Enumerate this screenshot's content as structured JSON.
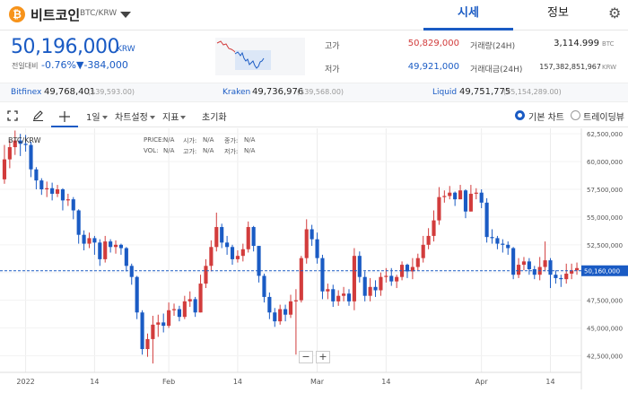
{
  "header": {
    "coin_symbol": "₿",
    "coin_name": "비트코인",
    "pair": "BTC/KRW",
    "tabs": [
      "시세",
      "정보"
    ],
    "settings_icon": "gear-icon"
  },
  "ticker": {
    "price": "50,196,000",
    "unit": "KRW",
    "change_label": "전일대비",
    "change_pct": "-0.76%",
    "change_amt": "▼-384,000",
    "color_down": "#1a5bc4",
    "color_up": "#d23c3c"
  },
  "stats": {
    "high_label": "고가",
    "high_value": "50,829,000",
    "low_label": "저가",
    "low_value": "49,921,000",
    "volume_label": "거래량(24H)",
    "volume_value": "3,114.999",
    "volume_unit": "BTC",
    "amount_label": "거래대금(24H)",
    "amount_value": "157,382,851,967",
    "amount_unit": "KRW"
  },
  "exchanges": [
    {
      "name": "Bitfinex",
      "price": "49,768,401",
      "sub": "($39,593.00)"
    },
    {
      "name": "Kraken",
      "price": "49,736,976",
      "sub": "($39,568.00)"
    },
    {
      "name": "Liquid",
      "price": "49,751,775",
      "sub": "(¥5,154,289.00)"
    }
  ],
  "toolbar": {
    "period": "1일",
    "chart_settings": "차트설정",
    "indicators": "지표",
    "reset": "초기화",
    "basic_chart": "기본 차트",
    "tradingview": "트레이딩뷰"
  },
  "legend": {
    "pair": "BTC/KRW",
    "price": "PRICE:",
    "price_v": "N/A",
    "open": "시가:",
    "open_v": "N/A",
    "close": "종가:",
    "close_v": "N/A",
    "vol": "VOL:",
    "vol_v": "N/A",
    "high": "고가:",
    "high_v": "N/A",
    "low": "저가:",
    "low_v": "N/A"
  },
  "chart_data": {
    "type": "candlestick",
    "ylim": [
      41000000,
      63000000
    ],
    "y_ticks": [
      "62,500,000",
      "60,000,000",
      "57,500,000",
      "55,000,000",
      "52,500,000",
      "50,000,000",
      "47,500,000",
      "45,000,000",
      "42,500,000"
    ],
    "y_tick_values": [
      62500000,
      60000000,
      57500000,
      55000000,
      52500000,
      50000000,
      47500000,
      45000000,
      42500000
    ],
    "x_labels": [
      "2022",
      "14",
      "Feb",
      "14",
      "Mar",
      "14",
      "Apr",
      "14",
      "Ma"
    ],
    "x_label_index": [
      4,
      17,
      31,
      44,
      59,
      72,
      90,
      103,
      121
    ],
    "current_price_label": "50,160,000",
    "current_price": 50160000,
    "candles": [
      [
        58.4,
        60.2,
        61.5,
        58.0
      ],
      [
        60.2,
        61.3,
        61.9,
        59.4
      ],
      [
        61.3,
        61.9,
        62.8,
        60.6
      ],
      [
        61.9,
        61.6,
        62.5,
        60.5
      ],
      [
        61.6,
        61.5,
        62.4,
        60.9
      ],
      [
        61.5,
        59.3,
        61.8,
        58.6
      ],
      [
        59.3,
        58.3,
        59.5,
        57.5
      ],
      [
        58.3,
        57.5,
        58.5,
        57.0
      ],
      [
        57.5,
        57.6,
        58.2,
        56.8
      ],
      [
        57.6,
        57.1,
        58.1,
        56.5
      ],
      [
        57.1,
        57.5,
        57.9,
        56.8
      ],
      [
        57.5,
        56.5,
        57.6,
        55.6
      ],
      [
        56.5,
        56.6,
        57.1,
        56.0
      ],
      [
        56.6,
        55.6,
        56.8,
        54.8
      ],
      [
        55.6,
        53.4,
        55.7,
        52.6
      ],
      [
        53.4,
        52.6,
        53.8,
        52.0
      ],
      [
        52.6,
        53.1,
        53.6,
        52.2
      ],
      [
        53.1,
        52.7,
        53.3,
        51.6
      ],
      [
        52.7,
        51.2,
        53.0,
        50.6
      ],
      [
        51.2,
        52.8,
        53.3,
        50.9
      ],
      [
        52.8,
        52.3,
        53.0,
        51.8
      ],
      [
        52.3,
        52.5,
        52.9,
        51.7
      ],
      [
        52.5,
        52.2,
        52.6,
        51.6
      ],
      [
        52.2,
        50.6,
        52.3,
        50.1
      ],
      [
        50.6,
        49.6,
        50.8,
        48.9
      ],
      [
        49.6,
        46.4,
        49.7,
        45.8
      ],
      [
        46.4,
        43.1,
        46.6,
        42.6
      ],
      [
        43.1,
        44.0,
        44.5,
        42.4
      ],
      [
        44.0,
        45.3,
        46.1,
        41.8
      ],
      [
        45.3,
        45.5,
        46.2,
        44.2
      ],
      [
        45.5,
        45.2,
        46.3,
        44.6
      ],
      [
        45.2,
        46.6,
        47.3,
        45.0
      ],
      [
        46.6,
        46.7,
        47.2,
        46.1
      ],
      [
        46.7,
        46.0,
        47.0,
        45.6
      ],
      [
        46.0,
        47.4,
        47.9,
        45.8
      ],
      [
        47.4,
        47.6,
        48.3,
        46.9
      ],
      [
        47.6,
        46.4,
        47.8,
        46.0
      ],
      [
        46.4,
        49.0,
        49.8,
        46.4
      ],
      [
        49.0,
        50.6,
        51.2,
        48.6
      ],
      [
        50.6,
        52.3,
        52.9,
        50.1
      ],
      [
        52.3,
        54.1,
        55.4,
        51.9
      ],
      [
        54.1,
        52.7,
        54.4,
        52.2
      ],
      [
        52.7,
        52.3,
        53.3,
        51.6
      ],
      [
        52.3,
        51.2,
        52.5,
        50.7
      ],
      [
        51.2,
        51.5,
        52.0,
        50.9
      ],
      [
        51.5,
        52.1,
        52.6,
        51.0
      ],
      [
        52.1,
        54.1,
        54.6,
        51.8
      ],
      [
        54.1,
        52.4,
        54.2,
        51.9
      ],
      [
        52.4,
        49.7,
        52.4,
        49.1
      ],
      [
        49.7,
        47.8,
        49.9,
        47.3
      ],
      [
        47.8,
        46.4,
        48.2,
        45.8
      ],
      [
        46.4,
        45.6,
        46.8,
        45.1
      ],
      [
        45.6,
        46.7,
        47.1,
        45.3
      ],
      [
        46.7,
        46.2,
        47.1,
        45.6
      ],
      [
        46.2,
        47.4,
        48.0,
        45.9
      ],
      [
        47.4,
        47.5,
        48.5,
        42.6
      ],
      [
        47.5,
        51.3,
        51.5,
        47.3
      ],
      [
        51.3,
        53.9,
        54.8,
        50.8
      ],
      [
        53.9,
        53.0,
        54.3,
        52.4
      ],
      [
        53.0,
        51.3,
        53.6,
        50.8
      ],
      [
        51.3,
        48.3,
        51.6,
        47.6
      ],
      [
        48.3,
        48.5,
        49.0,
        47.6
      ],
      [
        48.5,
        47.4,
        48.9,
        46.9
      ],
      [
        47.4,
        47.9,
        48.4,
        47.0
      ],
      [
        47.9,
        48.1,
        48.7,
        47.4
      ],
      [
        48.1,
        47.4,
        48.5,
        47.0
      ],
      [
        47.4,
        51.5,
        52.2,
        46.6
      ],
      [
        51.5,
        49.6,
        51.9,
        49.1
      ],
      [
        49.6,
        47.9,
        50.1,
        47.4
      ],
      [
        47.9,
        48.7,
        49.5,
        47.4
      ],
      [
        48.7,
        48.4,
        49.3,
        47.8
      ],
      [
        48.4,
        49.6,
        50.0,
        47.9
      ],
      [
        49.6,
        49.7,
        50.4,
        49.1
      ],
      [
        49.7,
        49.2,
        50.4,
        48.8
      ],
      [
        49.2,
        49.6,
        49.8,
        48.6
      ],
      [
        49.6,
        50.7,
        51.0,
        49.3
      ],
      [
        50.7,
        50.1,
        50.8,
        49.5
      ],
      [
        50.1,
        50.5,
        51.3,
        49.4
      ],
      [
        50.5,
        51.3,
        51.7,
        50.2
      ],
      [
        51.3,
        52.5,
        53.3,
        50.9
      ],
      [
        52.5,
        53.3,
        54.0,
        52.1
      ],
      [
        53.3,
        54.7,
        55.6,
        52.8
      ],
      [
        54.7,
        56.8,
        57.7,
        54.3
      ],
      [
        56.8,
        56.9,
        57.4,
        56.3
      ],
      [
        56.9,
        57.2,
        57.8,
        56.6
      ],
      [
        57.2,
        56.6,
        57.3,
        56.0
      ],
      [
        56.6,
        57.4,
        57.9,
        56.6
      ],
      [
        57.4,
        55.5,
        57.5,
        54.9
      ],
      [
        55.5,
        57.1,
        57.9,
        55.5
      ],
      [
        57.1,
        57.2,
        57.6,
        56.6
      ],
      [
        57.2,
        56.3,
        57.5,
        55.8
      ],
      [
        56.3,
        53.2,
        56.7,
        52.7
      ],
      [
        53.2,
        53.1,
        53.9,
        52.6
      ],
      [
        53.1,
        52.6,
        53.3,
        52.1
      ],
      [
        52.6,
        52.5,
        53.0,
        51.8
      ],
      [
        52.5,
        52.2,
        52.8,
        51.6
      ],
      [
        52.2,
        49.8,
        52.3,
        49.4
      ],
      [
        49.8,
        50.7,
        51.3,
        49.5
      ],
      [
        50.7,
        51.0,
        51.4,
        50.2
      ],
      [
        51.0,
        50.3,
        51.3,
        49.8
      ],
      [
        50.3,
        49.8,
        50.6,
        49.4
      ],
      [
        49.8,
        50.5,
        51.4,
        49.3
      ],
      [
        50.5,
        51.1,
        52.8,
        50.1
      ],
      [
        51.1,
        49.8,
        51.3,
        48.6
      ],
      [
        49.8,
        49.5,
        50.2,
        49.0
      ],
      [
        49.5,
        49.4,
        49.8,
        48.7
      ],
      [
        49.4,
        49.9,
        50.8,
        49.0
      ],
      [
        49.9,
        50.2,
        50.8,
        49.4
      ],
      [
        50.2,
        50.4,
        50.9,
        49.8
      ]
    ]
  }
}
